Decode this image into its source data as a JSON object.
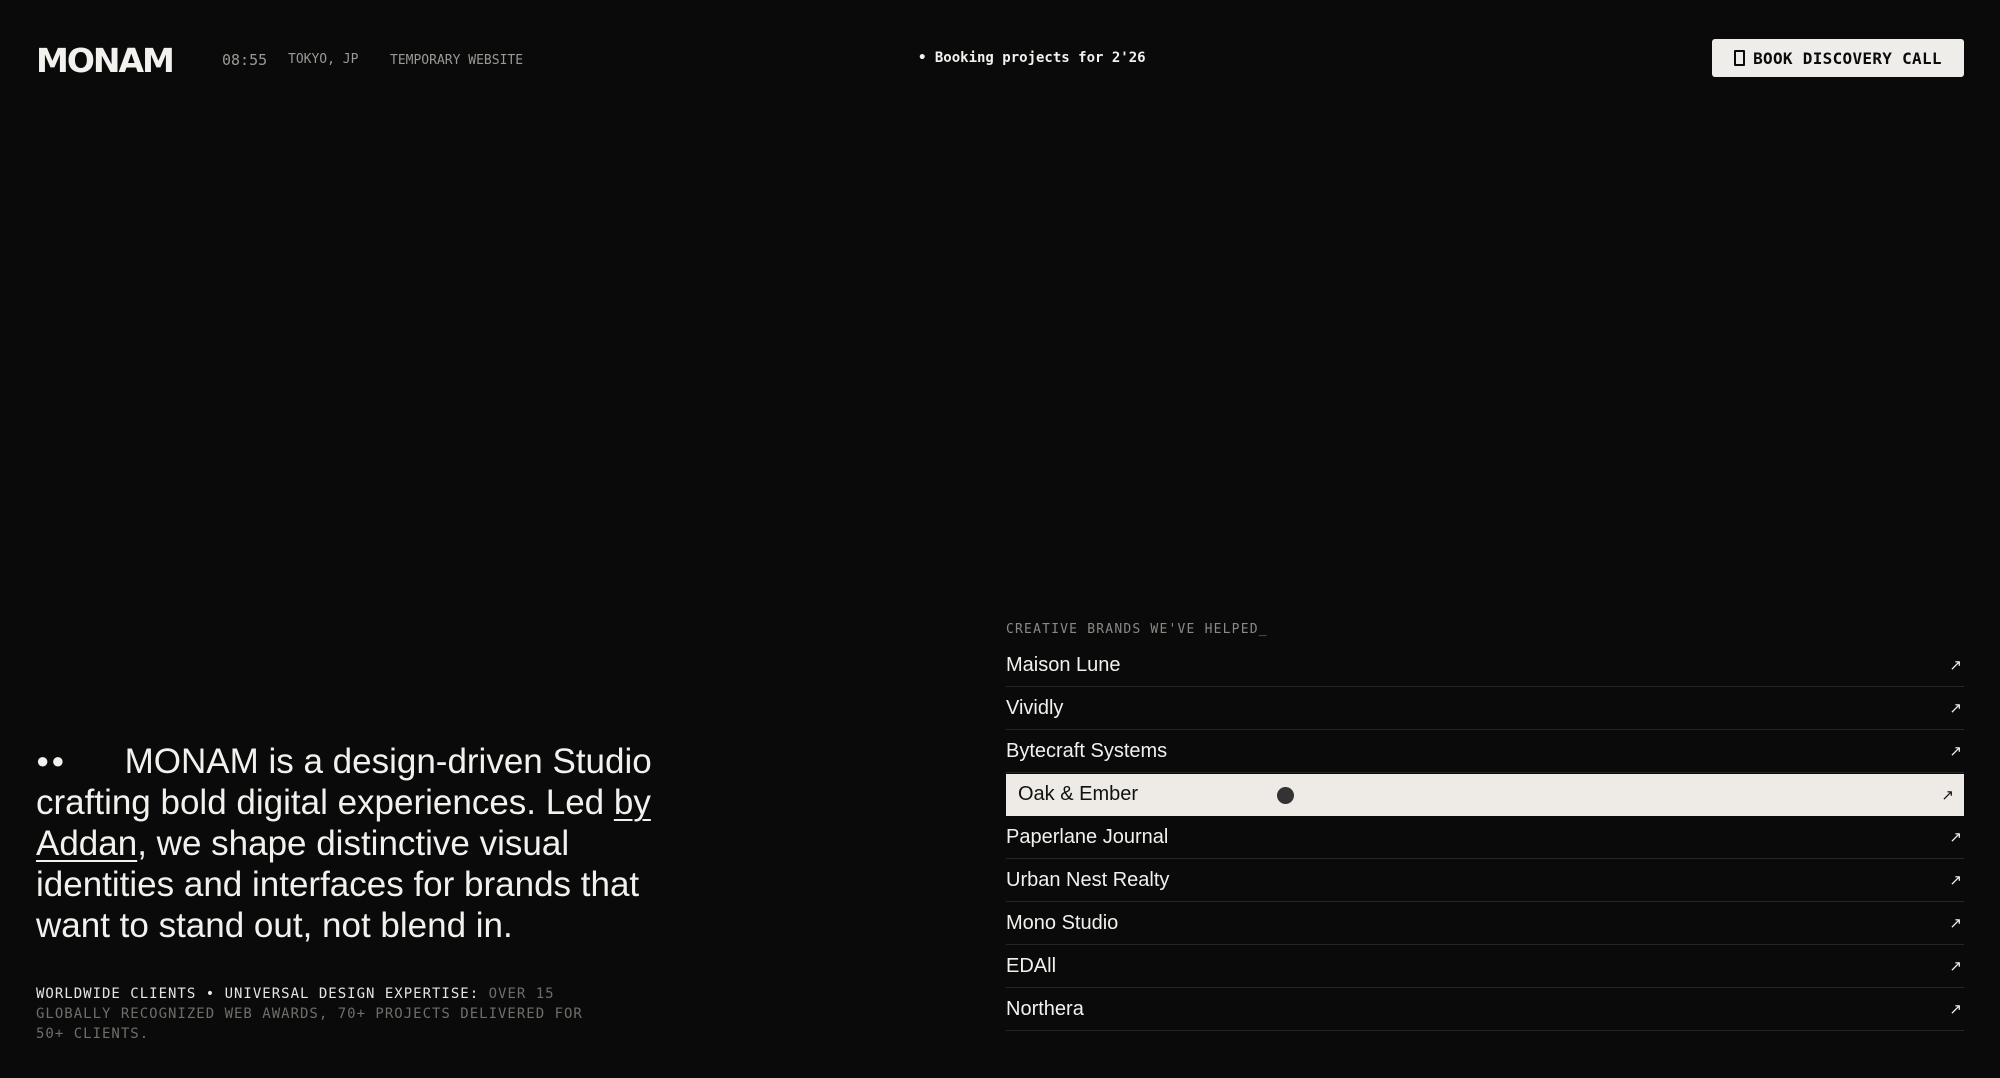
{
  "header": {
    "logo": "MONAM",
    "time": "08:55",
    "location": "TOKYO, JP",
    "site_note": "TEMPORARY WEBSITE",
    "booking": "• Booking projects for 2'26",
    "cta_label": "BOOK DISCOVERY CALL",
    "cta_icon": "phone-icon"
  },
  "intro": {
    "dots": "●●",
    "text_before": "MONAM is a design-driven Studio crafting bold digital experiences. Led ",
    "link": "by Addan",
    "text_after": ", we shape distinctive visual identities and interfaces for brands that want to stand out, not blend in."
  },
  "stats": {
    "highlight": "WORLDWIDE CLIENTS • UNIVERSAL DESIGN EXPERTISE:",
    "muted": "OVER 15 GLOBALLY RECOGNIZED WEB AWARDS, 70+ PROJECTS DELIVERED FOR 50+ CLIENTS."
  },
  "clients": {
    "heading": "CREATIVE BRANDS WE'VE HELPED_",
    "arrow": "↗",
    "active_index": 3,
    "items": [
      "Maison Lune",
      "Vividly",
      "Bytecraft Systems",
      "Oak & Ember",
      "Paperlane Journal",
      "Urban Nest Realty",
      "Mono Studio",
      "EDAll",
      "Northera"
    ]
  },
  "colors": {
    "background": "#0a0a0a",
    "text": "#f2f1ed",
    "muted": "#6f6e69",
    "highlight_row": "#eeebe6"
  }
}
